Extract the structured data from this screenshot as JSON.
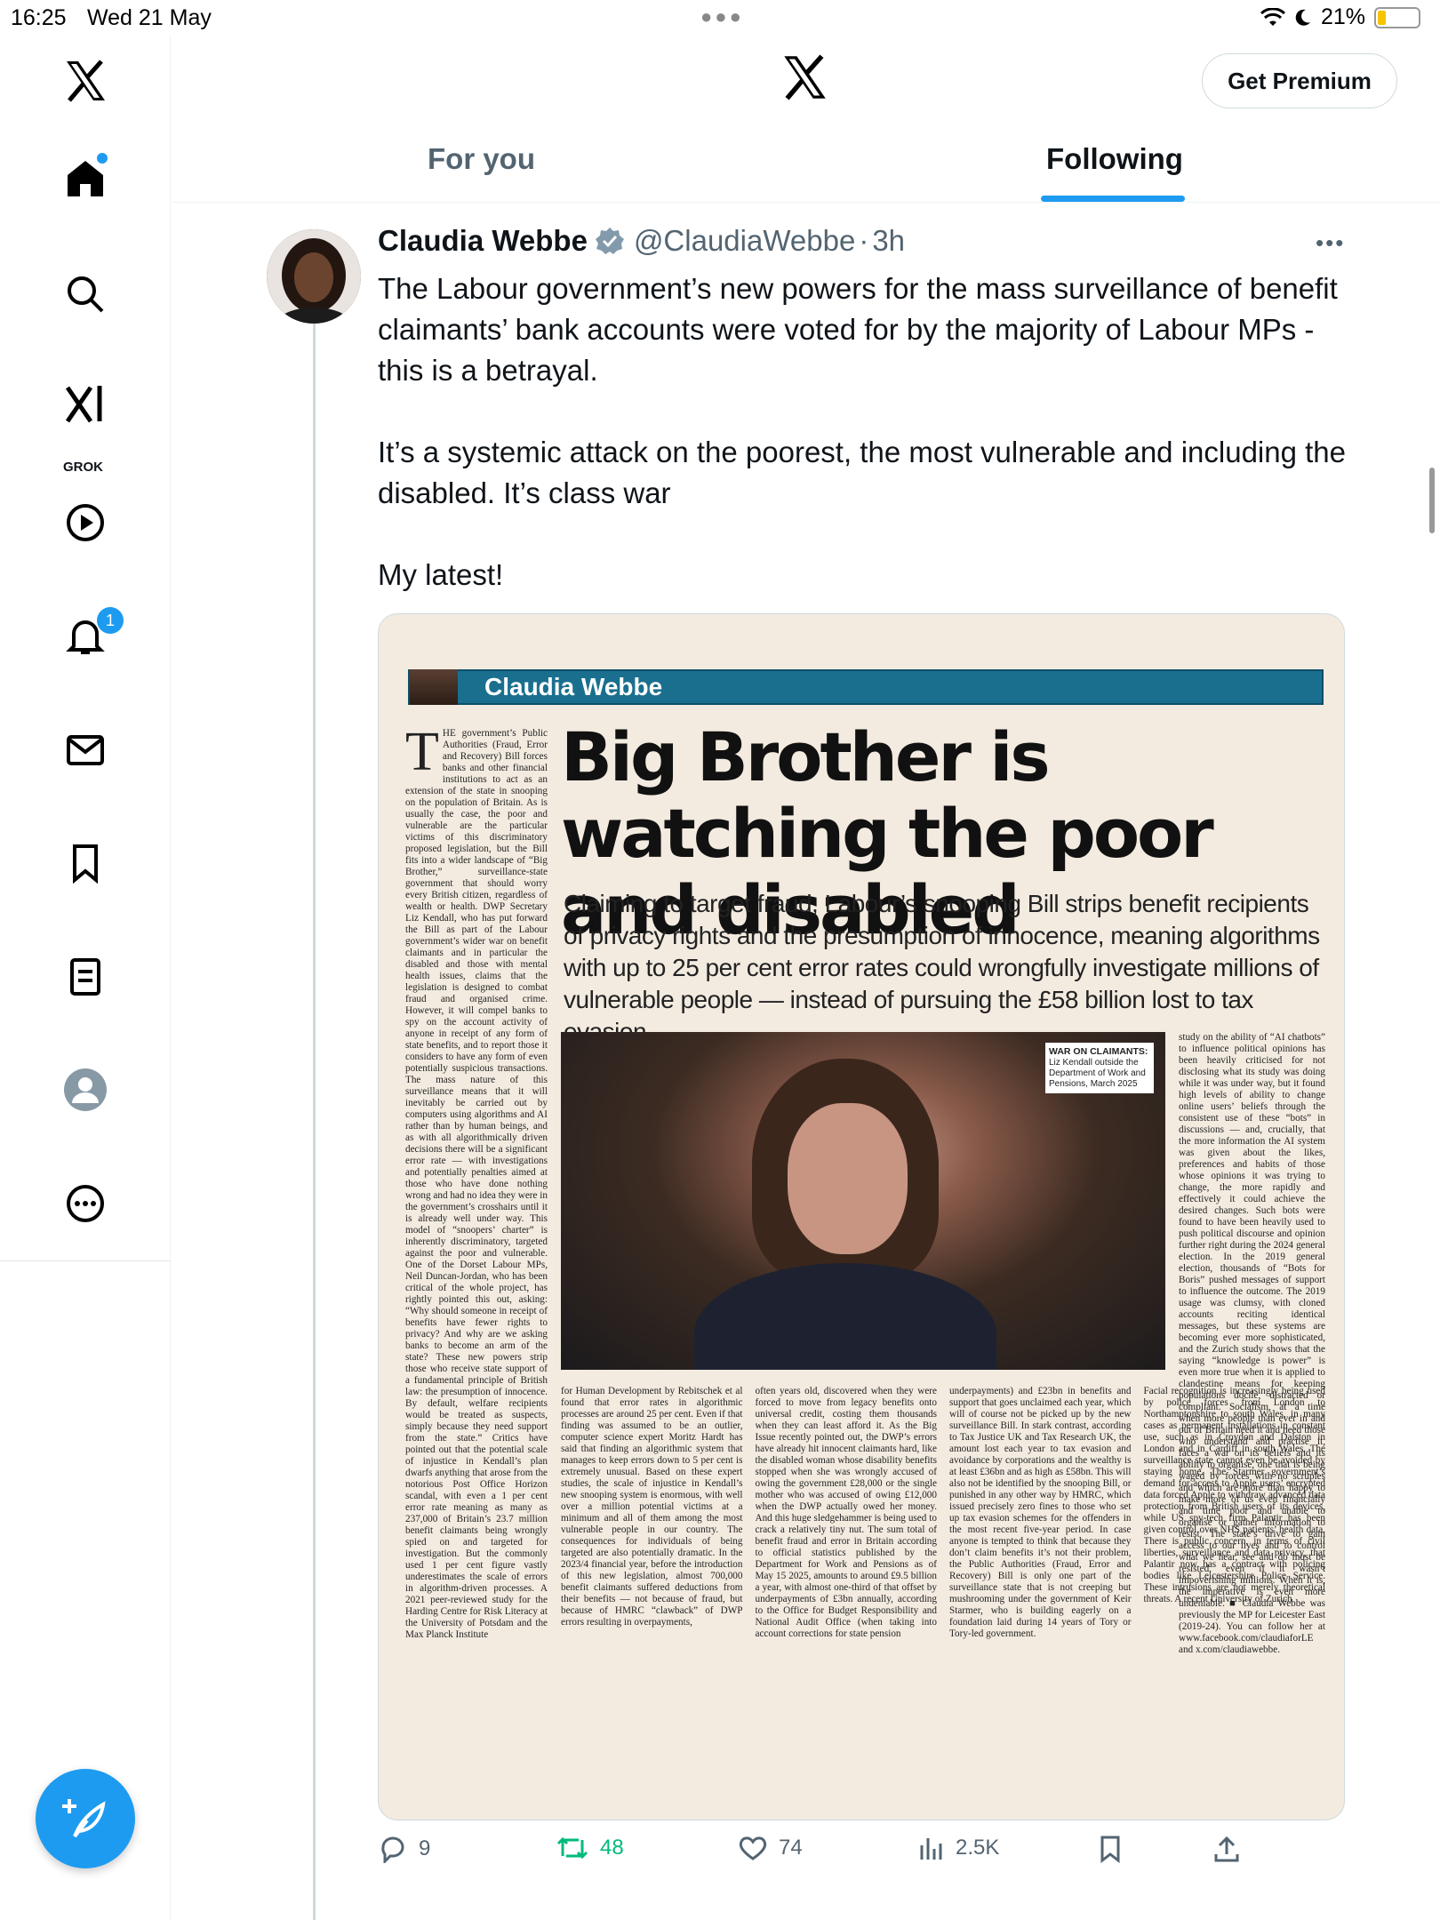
{
  "status_bar": {
    "time": "16:25",
    "date": "Wed 21 May",
    "battery": "21%",
    "battery_level": 0.21
  },
  "sidebar": {
    "grok_label": "GROK",
    "notifications_count": "1",
    "items": [
      "home",
      "explore",
      "grok",
      "videos",
      "notifications",
      "messages",
      "bookmarks",
      "lists",
      "profile",
      "more"
    ]
  },
  "header": {
    "premium_label": "Get Premium",
    "tabs": [
      {
        "label": "For you",
        "active": false
      },
      {
        "label": "Following",
        "active": true
      }
    ]
  },
  "tweet": {
    "author_name": "Claudia Webbe",
    "author_handle": "@ClaudiaWebbe",
    "separator": "·",
    "age": "3h",
    "paragraphs": [
      "The Labour government’s new powers for the mass surveillance of benefit claimants’ bank accounts were voted for by the majority of Labour MPs - this is a betrayal.",
      "It’s a systemic attack on the poorest, the most vulnerable and including the disabled. It’s class war",
      "My latest!"
    ],
    "stats": {
      "replies": "9",
      "reposts": "48",
      "likes": "74",
      "views": "2.5K"
    }
  },
  "article": {
    "banner_name": "Claudia Webbe",
    "headline": "Big Brother is watching the poor and disabled",
    "standfirst": "Claiming to target fraud, Labour’s snooping Bill strips benefit recipients of privacy rights and the presumption of innocence, meaning algorithms with up to 25 per cent error rates could wrongfully investigate millions of vulnerable people — instead of pursuing the £58 billion lost to tax evasion",
    "caption_title": "WAR ON CLAIMANTS:",
    "caption_text": "Liz Kendall outside the Department of Work and Pensions, March 2025",
    "left_dropcap": "T",
    "left_column": "HE government’s Public Authorities (Fraud, Error and Recovery) Bill forces banks and other financial institutions to act as an extension of the state in snooping on the population of Britain. As is usually the case, the poor and vulnerable are the particular victims of this discriminatory proposed legislation, but the Bill fits into a wider landscape of “Big Brother,” surveillance-state government that should worry every British citizen, regardless of wealth or health. DWP Secretary Liz Kendall, who has put forward the Bill as part of the Labour government’s wider war on benefit claimants and in particular the disabled and those with mental health issues, claims that the legislation is designed to combat fraud and organised crime. However, it will compel banks to spy on the account activity of anyone in receipt of any form of state benefits, and to report those it considers to have any form of even potentially suspicious transactions. The mass nature of this surveillance means that it will inevitably be carried out by computers using algorithms and AI rather than by human beings, and as with all algorithmically driven decisions there will be a significant error rate — with investigations and potentially penalties aimed at those who have done nothing wrong and had no idea they were in the government’s crosshairs until it is already well under way. This model of “snoopers’ charter” is inherently discriminatory, targeted against the poor and vulnerable. One of the Dorset Labour MPs, Neil Duncan-Jordan, who has been critical of the whole project, has rightly pointed this out, asking: “Why should someone in receipt of benefits have fewer rights to privacy? And why are we asking banks to become an arm of the state? These new powers strip those who receive state support of a fundamental principle of British law: the presumption of innocence. By default, welfare recipients would be treated as suspects, simply because they need support from the state.” Critics have pointed out that the potential scale of injustice in Kendall’s plan dwarfs anything that arose from the notorious Post Office Horizon scandal, with even a 1 per cent error rate meaning as many as 237,000 of Britain’s 23.7 million benefit claimants being wrongly spied on and targeted for investigation. But the commonly used 1 per cent figure vastly underestimates the scale of errors in algorithm-driven processes. A 2021 peer-reviewed study for the Harding Centre for Risk Literacy at the University of Potsdam and the Max Planck Institute",
    "right_column": "study on the ability of “AI chatbots” to influence political opinions has been heavily criticised for not disclosing what its study was doing while it was under way, but it found high levels of ability to change online users’ beliefs through the consistent use of these “bots” in discussions — and, crucially, that the more information the AI system was given about the likes, preferences and habits of those whose opinions it was trying to change, the more rapidly and effectively it could achieve the desired changes. Such bots were found to have been heavily used to push political discourse and opinion further right during the 2024 general election. In the 2019 general election, thousands of “Bots for Boris” pushed messages of support to influence the outcome. The 2019 usage was clumsy, with cloned accounts reciting identical messages, but these systems are becoming ever more sophisticated, and the Zurich study shows that the saying “knowledge is power” is even more true when it is applied to clandestine means for keeping populations docile, distracted or compliant. Socialism, at a time when more people than ever in and out of Britain need it and need those who understand and practise it, faces a war on its beliefs and its ability to organise, one that is being waged by forces with no scruples and which are more than happy to make more of us even financially and time poor and unable to organise or gather information to resist. The state’s drive to gain access to our lives and to control what we hear, see and do must be resisted, even if it wasn’t impoverishing millions. When it is, the imperative is even more undeniable. ■ Claudia Webbe was previously the MP for Leicester East (2019-24). You can follow her at www.facebook.com/claudiaforLE and x.com/claudiawebbe.",
    "lower_columns": [
      "for Human Development by Rebitschek et al found that error rates in algorithmic processes are around 25 per cent. Even if that finding was assumed to be an outlier, computer science expert Moritz Hardt has said that finding an algorithmic system that manages to keep errors down to 5 per cent is extremely unusual. Based on these expert studies, the scale of injustice in Kendall’s new snooping system is enormous, with well over a million potential victims at a minimum and all of them among the most vulnerable people in our country. The consequences for individuals of being targeted are also potentially dramatic. In the 2023/4 financial year, before the introduction of this new legislation, almost 700,000 benefit claimants suffered deductions from their benefits — not because of fraud, but because of HMRC “clawback” of DWP errors resulting in overpayments,",
      "often years old, discovered when they were forced to move from legacy benefits onto universal credit, costing them thousands when they can least afford it. As the Big Issue recently pointed out, the DWP’s errors have already hit innocent claimants hard, like the disabled woman whose disability benefits stopped when she was wrongly accused of owing the government £28,000 or the single mother who was accused of owing £12,000 when the DWP actually owed her money. And this huge sledgehammer is being used to crack a relatively tiny nut. The sum total of benefit fraud and error in Britain according to official statistics published by the Department for Work and Pensions as of May 15 2025, amounts to around £9.5 billion a year, with almost one-third of that offset by underpayments of £3bn annually, according to the Office for Budget Responsibility and National Audit Office (when taking into account corrections for state pension",
      "underpayments) and £23bn in benefits and support that goes unclaimed each year, which will of course not be picked up by the new surveillance Bill. In stark contrast, according to Tax Justice UK and Tax Research UK, the amount lost each year to tax evasion and avoidance by corporations and the wealthy is at least £36bn and as high as £58bn. This will also not be identified by the snooping Bill, or punished in any other way by HMRC, which issued precisely zero fines to those who set up tax evasion schemes for the offenders in the most recent five-year period. In case anyone is tempted to think that because they don’t claim benefits it’s not their problem, the Public Authorities (Fraud, Error and Recovery) Bill is only one part of the surveillance state that is not creeping but mushrooming under the government of Keir Starmer, who is building eagerly on a foundation laid during 14 years of Tory or Tory-led government.",
      "Facial recognition is increasingly being used by police forces from London to Northamptonshire to south Wales, in many cases as permanent installations in constant use, such as in Croydon and Dalston in London and in Cardiff in south Wales. The surveillance state cannot even be avoided by staying home. The Starmer government’s demand for access to Apple users’ encrypted data forced Apple to withdraw advanced data protection from British users of its devices, while US spy-tech firm Palantir has been given control over NHS patients’ health data. There is public concern, in terms of civil liberties, surveillance and data privacy, that Palantir now has a contract with policing bodies like Leicestershire Police Service. These intrusions are not merely theoretical threats. A recent University of Zurich"
    ]
  },
  "colors": {
    "accent": "#1d9bf0",
    "retweet_green": "#00ba7c",
    "muted_text": "#536471",
    "banner": "#1a6f8f"
  }
}
